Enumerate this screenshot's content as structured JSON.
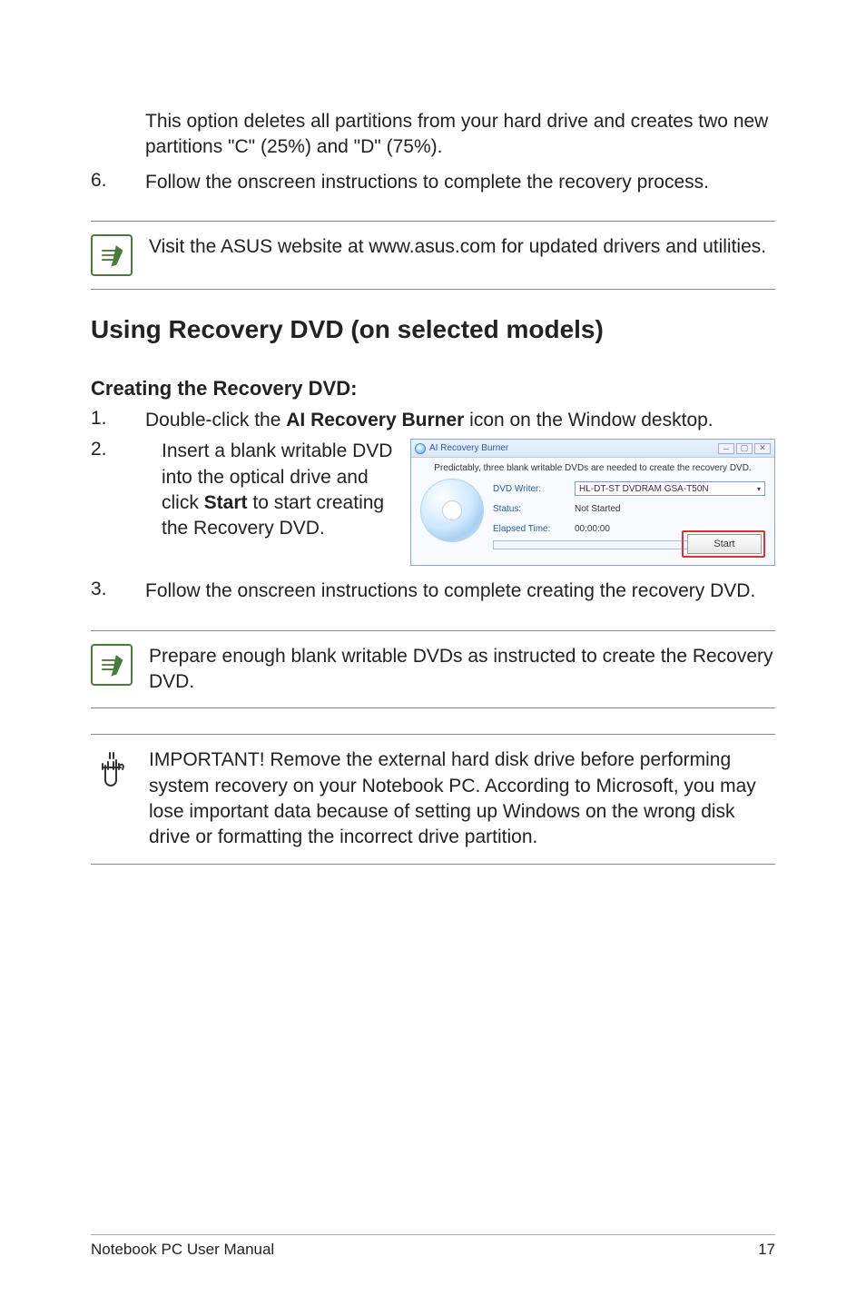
{
  "intro_option": "This option deletes all partitions from your hard drive and creates two new partitions \"C\" (25%) and \"D\" (75%).",
  "step6_num": "6.",
  "step6_text": "Follow the onscreen instructions to complete the recovery process.",
  "note1": "Visit the ASUS website at www.asus.com for updated drivers and utilities.",
  "section_heading": "Using Recovery DVD (on selected models)",
  "subheading": "Creating the Recovery DVD:",
  "step1_num": "1.",
  "step1_pre": "Double-click the ",
  "step1_bold": "AI Recovery Burner",
  "step1_post": " icon on the Window desktop.",
  "step2_num": "2.",
  "step2_pre": "Insert a blank writable DVD into the optical drive and click ",
  "step2_bold": "Start",
  "step2_post": " to start creating the Recovery DVD.",
  "ai_window": {
    "title": "AI Recovery Burner",
    "message": "Predictably, three blank writable DVDs are needed to create the recovery DVD.",
    "writer_label": "DVD Writer:",
    "writer_value": "HL-DT-ST DVDRAM GSA-T50N",
    "status_label": "Status:",
    "status_value": "Not Started",
    "elapsed_label": "Elapsed Time:",
    "elapsed_value": "00:00:00",
    "start_button": "Start"
  },
  "step3_num": "3.",
  "step3_text": "Follow the onscreen instructions to complete creating the recovery DVD.",
  "note2": "Prepare enough blank writable DVDs as instructed to create the Recovery DVD.",
  "important": "IMPORTANT! Remove the external hard disk drive before performing system recovery on your Notebook PC. According to Microsoft, you may lose important data because of setting up Windows on the wrong disk drive or formatting the incorrect drive partition.",
  "footer_left": "Notebook PC User Manual",
  "footer_right": "17"
}
